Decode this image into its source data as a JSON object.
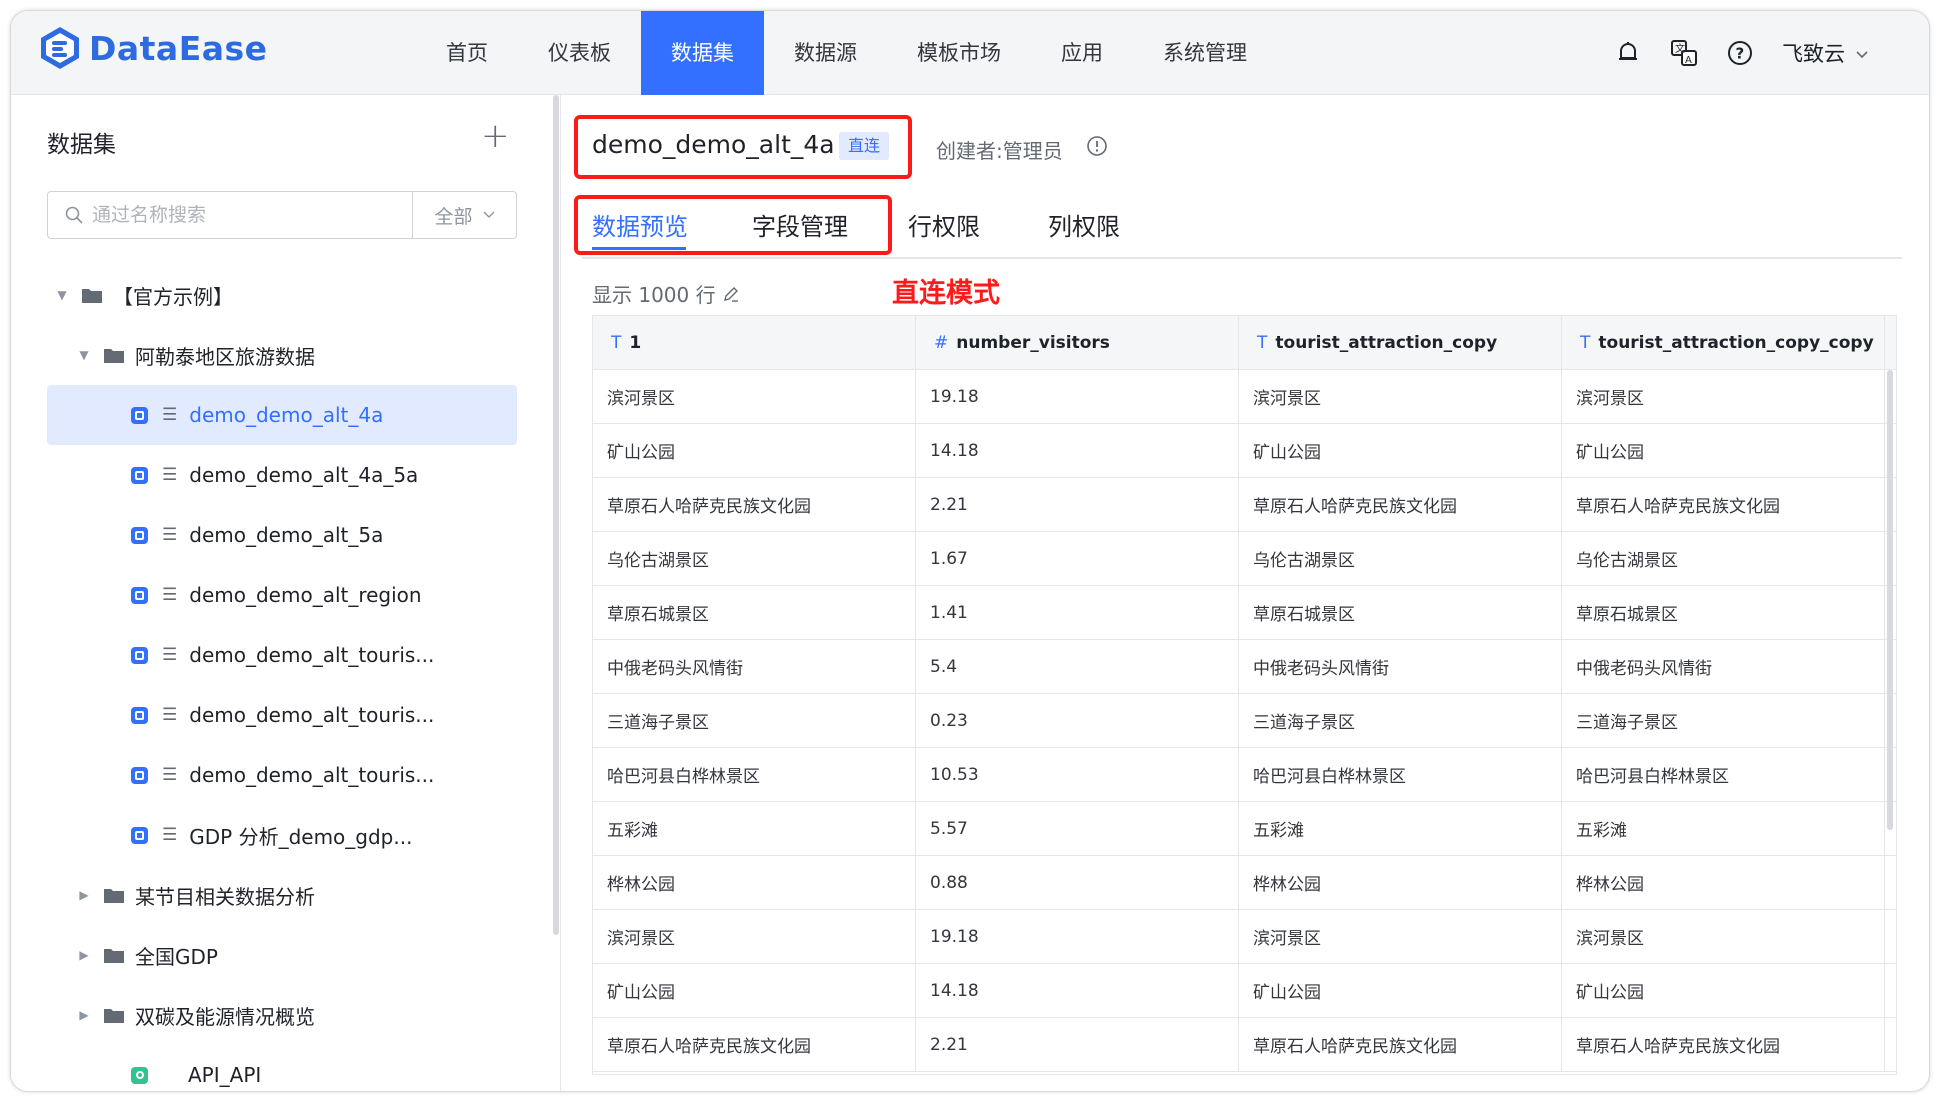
{
  "app": {
    "brand": "DataEase",
    "accent": "#3370ff"
  },
  "nav": {
    "items": [
      {
        "label": "首页"
      },
      {
        "label": "仪表板"
      },
      {
        "label": "数据集",
        "active": true
      },
      {
        "label": "数据源"
      },
      {
        "label": "模板市场"
      },
      {
        "label": "应用"
      },
      {
        "label": "系统管理"
      }
    ]
  },
  "header": {
    "user": "飞致云"
  },
  "sidebar": {
    "title": "数据集",
    "search": {
      "placeholder": "通过名称搜索",
      "filter": "全部"
    },
    "tree": [
      {
        "type": "folder",
        "level": 0,
        "label": "【官方示例】",
        "expanded": true
      },
      {
        "type": "folder",
        "level": 1,
        "label": "阿勒泰地区旅游数据",
        "expanded": true
      },
      {
        "type": "dataset",
        "label": "demo_demo_alt_4a",
        "selected": true
      },
      {
        "type": "dataset",
        "label": "demo_demo_alt_4a_5a"
      },
      {
        "type": "dataset",
        "label": "demo_demo_alt_5a"
      },
      {
        "type": "dataset",
        "label": "demo_demo_alt_region"
      },
      {
        "type": "dataset",
        "label": "demo_demo_alt_touris..."
      },
      {
        "type": "dataset",
        "label": "demo_demo_alt_touris..."
      },
      {
        "type": "dataset",
        "label": "demo_demo_alt_touris..."
      },
      {
        "type": "dataset",
        "label": "GDP 分析_demo_gdp..."
      },
      {
        "type": "folder",
        "level": 1,
        "label": "某节目相关数据分析",
        "expanded": false
      },
      {
        "type": "folder",
        "level": 1,
        "label": "全国GDP",
        "expanded": false
      },
      {
        "type": "folder",
        "level": 1,
        "label": "双碳及能源情况概览",
        "expanded": false
      },
      {
        "type": "api",
        "label": "API_API"
      }
    ]
  },
  "dataset": {
    "name": "demo_demo_alt_4a",
    "tag": "直连",
    "creator": "创建者:管理员",
    "tabs": [
      "数据预览",
      "字段管理",
      "行权限",
      "列权限"
    ],
    "active_tab": "数据预览",
    "show_rows": "显示 1000 行",
    "mode_note": "直连模式"
  },
  "table": {
    "columns": [
      {
        "type_icon": "T",
        "name": "1"
      },
      {
        "type_icon": "#",
        "name": "number_visitors"
      },
      {
        "type_icon": "T",
        "name": "tourist_attraction_copy"
      },
      {
        "type_icon": "T",
        "name": "tourist_attraction_copy_copy"
      }
    ],
    "rows": [
      [
        "滨河景区",
        "19.18",
        "滨河景区",
        "滨河景区"
      ],
      [
        "矿山公园",
        "14.18",
        "矿山公园",
        "矿山公园"
      ],
      [
        "草原石人哈萨克民族文化园",
        "2.21",
        "草原石人哈萨克民族文化园",
        "草原石人哈萨克民族文化园"
      ],
      [
        "乌伦古湖景区",
        "1.67",
        "乌伦古湖景区",
        "乌伦古湖景区"
      ],
      [
        "草原石城景区",
        "1.41",
        "草原石城景区",
        "草原石城景区"
      ],
      [
        "中俄老码头风情街",
        "5.4",
        "中俄老码头风情街",
        "中俄老码头风情街"
      ],
      [
        "三道海子景区",
        "0.23",
        "三道海子景区",
        "三道海子景区"
      ],
      [
        "哈巴河县白桦林景区",
        "10.53",
        "哈巴河县白桦林景区",
        "哈巴河县白桦林景区"
      ],
      [
        "五彩滩",
        "5.57",
        "五彩滩",
        "五彩滩"
      ],
      [
        "桦林公园",
        "0.88",
        "桦林公园",
        "桦林公园"
      ],
      [
        "滨河景区",
        "19.18",
        "滨河景区",
        "滨河景区"
      ],
      [
        "矿山公园",
        "14.18",
        "矿山公园",
        "矿山公园"
      ],
      [
        "草原石人哈萨克民族文化园",
        "2.21",
        "草原石人哈萨克民族文化园",
        "草原石人哈萨克民族文化园"
      ]
    ]
  }
}
